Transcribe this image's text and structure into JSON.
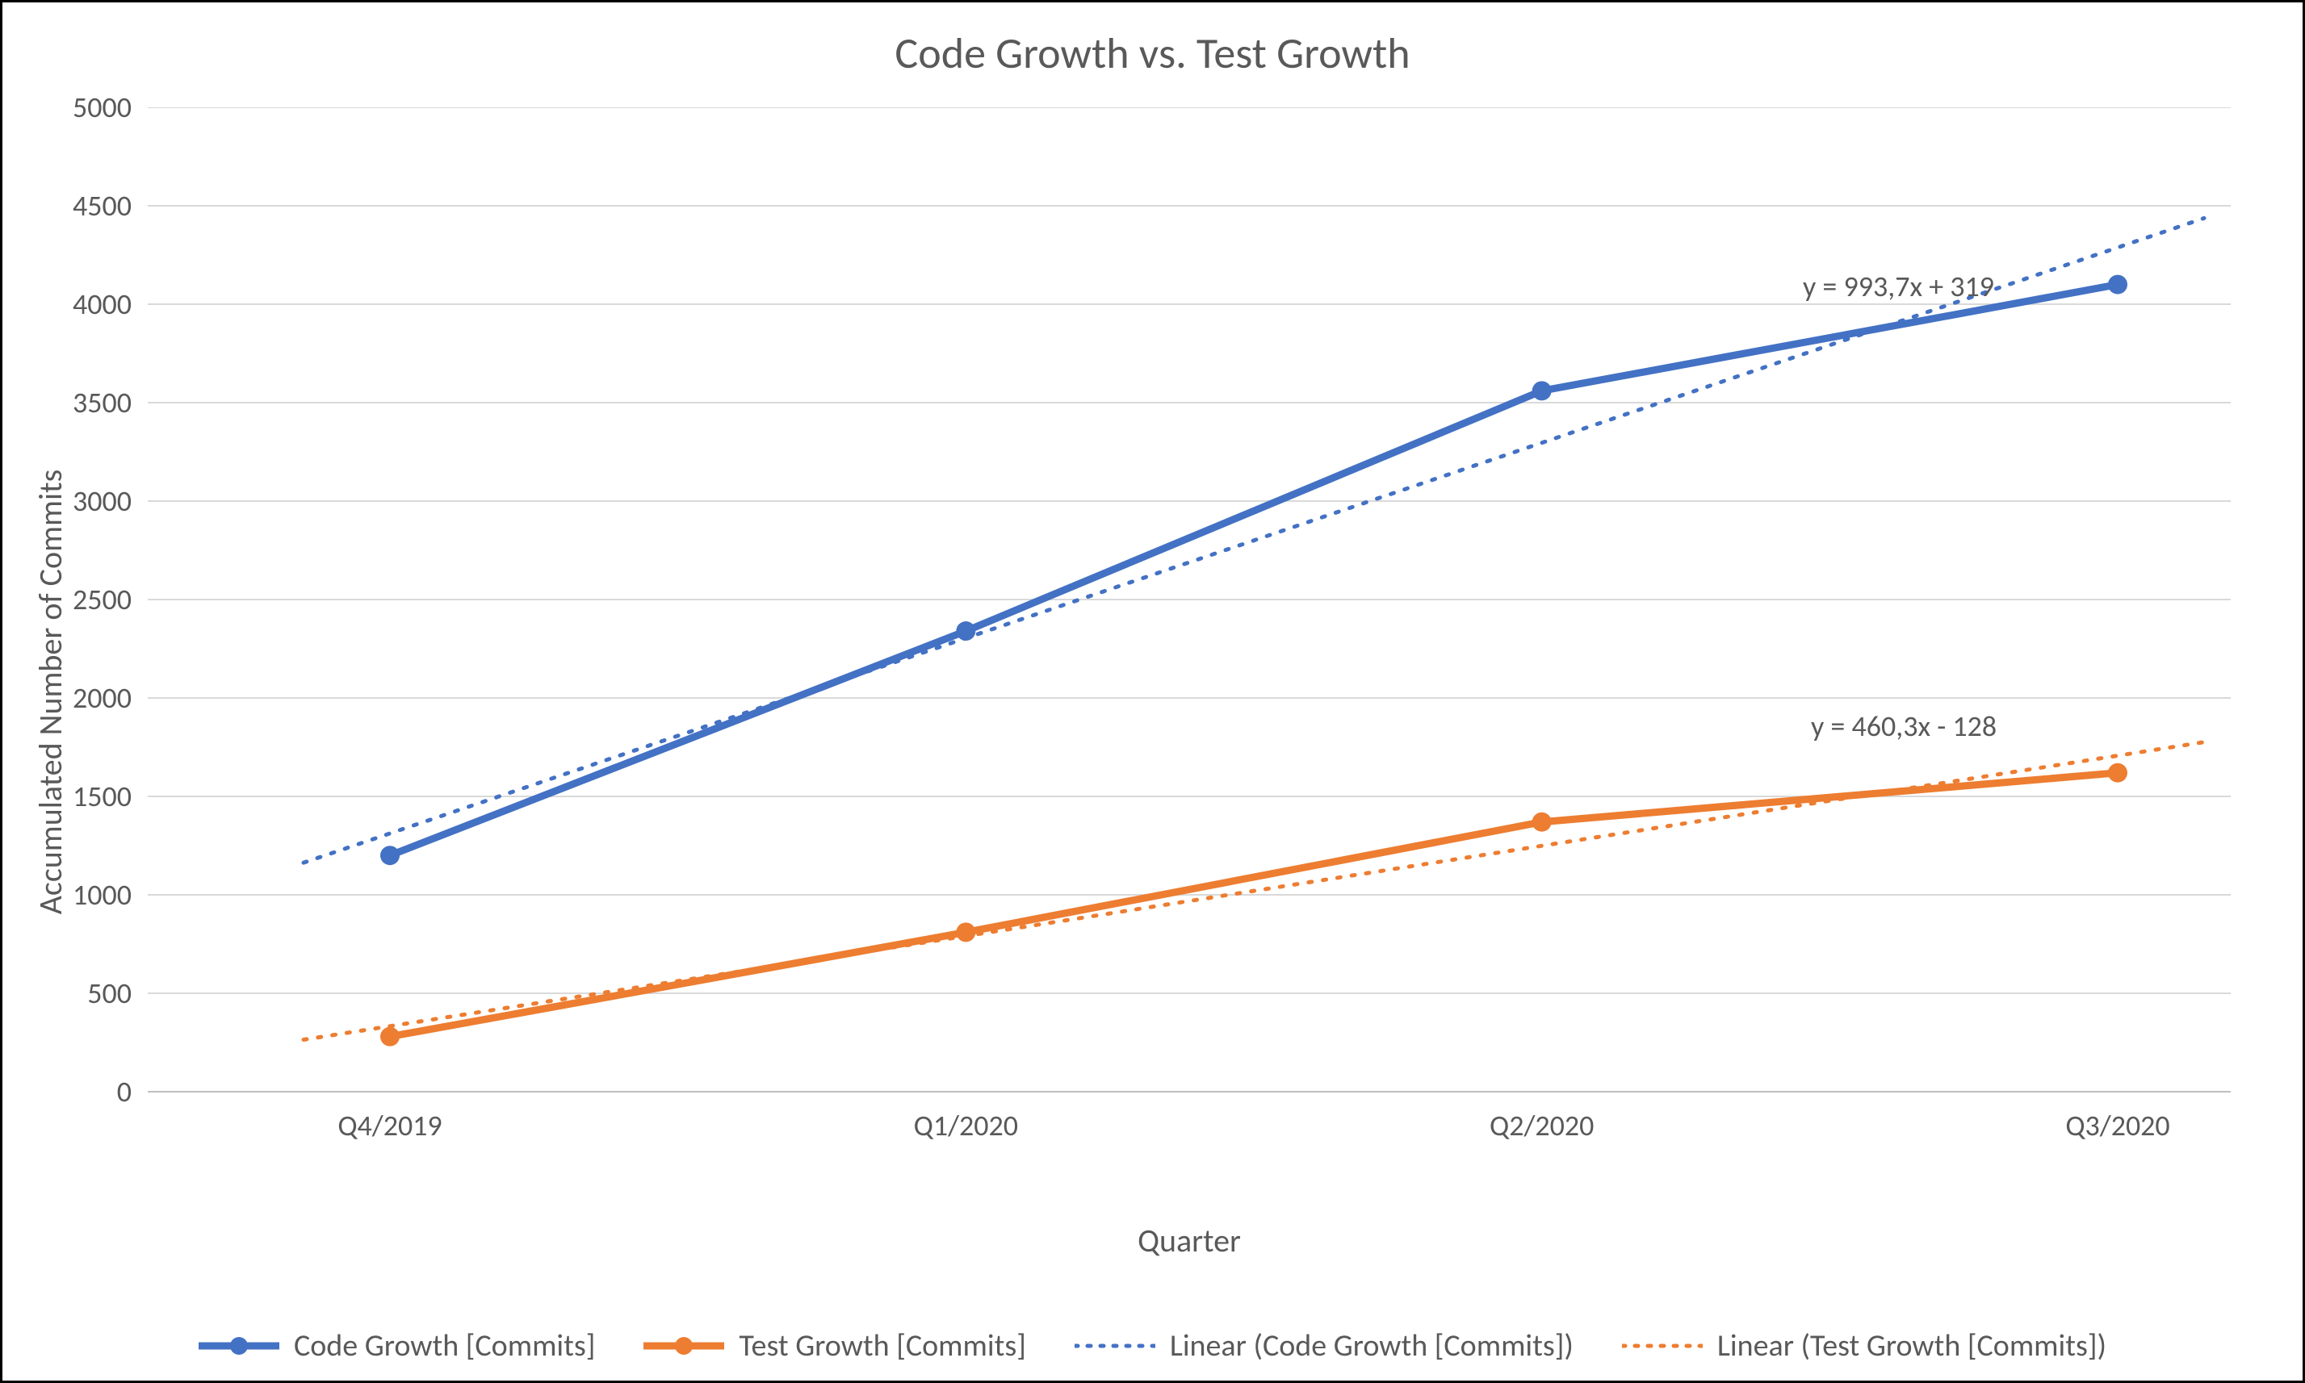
{
  "chart_data": {
    "type": "line",
    "title": "Code Growth vs. Test Growth",
    "xlabel": "Quarter",
    "ylabel": "Accumulated Number of Commits",
    "categories": [
      "Q4/2019",
      "Q1/2020",
      "Q2/2020",
      "Q3/2020"
    ],
    "ylim": [
      0,
      5000
    ],
    "y_ticks": [
      0,
      500,
      1000,
      1500,
      2000,
      2500,
      3000,
      3500,
      4000,
      4500,
      5000
    ],
    "series": [
      {
        "name": "Code Growth [Commits]",
        "values": [
          1200,
          2340,
          3560,
          4100
        ],
        "color": "#4371C4",
        "style": "solid",
        "marker": true
      },
      {
        "name": "Test Growth [Commits]",
        "values": [
          280,
          810,
          1370,
          1620
        ],
        "color": "#ED7D31",
        "style": "solid",
        "marker": true
      },
      {
        "name": "Linear (Code Growth [Commits])",
        "trend_of": 0,
        "color": "#4371C4",
        "style": "dotted",
        "marker": false,
        "equation": "y = 993,7x + 319"
      },
      {
        "name": "Linear (Test Growth [Commits])",
        "trend_of": 1,
        "color": "#ED7D31",
        "style": "dotted",
        "marker": false,
        "equation": "y = 460,3x - 128"
      }
    ],
    "legend_position": "bottom",
    "grid": {
      "horizontal": true,
      "vertical": false
    }
  }
}
